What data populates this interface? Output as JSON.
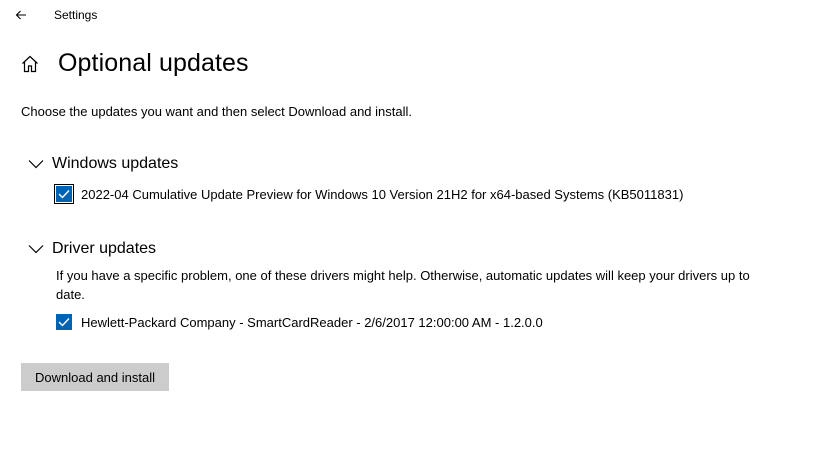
{
  "window": {
    "app_title": "Settings"
  },
  "header": {
    "title": "Optional updates",
    "subtitle": "Choose the updates you want and then select Download and install."
  },
  "sections": {
    "windows_updates": {
      "label": "Windows updates",
      "items": [
        {
          "label": "2022-04 Cumulative Update Preview for Windows 10 Version 21H2 for x64-based Systems (KB5011831)",
          "checked": true
        }
      ]
    },
    "driver_updates": {
      "label": "Driver updates",
      "description": "If you have a specific problem, one of these drivers might help. Otherwise, automatic updates will keep your drivers up to date.",
      "items": [
        {
          "label": "Hewlett-Packard Company - SmartCardReader - 2/6/2017 12:00:00 AM - 1.2.0.0",
          "checked": true
        }
      ]
    }
  },
  "actions": {
    "download_install_label": "Download and install"
  },
  "colors": {
    "accent": "#0063b1",
    "button_bg": "#cccccc",
    "background": "#ffffff"
  },
  "icons": {
    "back": "back-arrow-icon",
    "home": "home-icon",
    "expand": "chevron-down-icon",
    "check": "checkmark-icon"
  }
}
